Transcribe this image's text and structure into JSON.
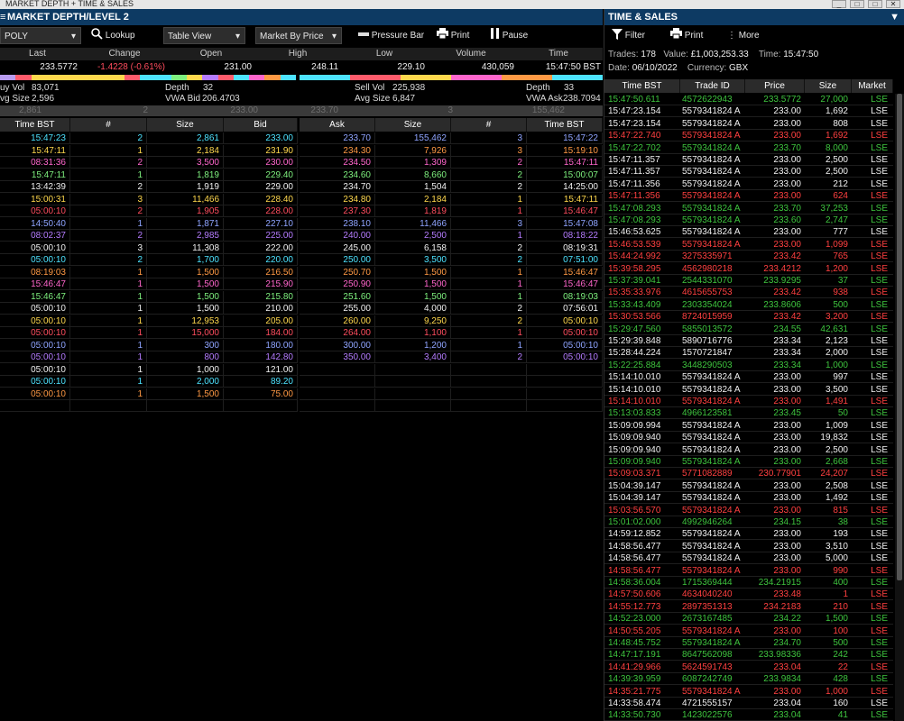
{
  "window": {
    "title": "MARKET DEPTH + TIME & SALES"
  },
  "md": {
    "title": "MARKET DEPTH/LEVEL 2",
    "symbol": "POLY",
    "lookup": "Lookup",
    "view": "Table View",
    "mode": "Market By Price",
    "pressure": "Pressure Bar",
    "print": "Print",
    "pause": "Pause"
  },
  "summary": {
    "headers": [
      "Last",
      "Change",
      "Open",
      "High",
      "Low",
      "Volume",
      "Time"
    ],
    "values": [
      "233.5772",
      "-1.4228 (-0.61%)",
      "231.00",
      "248.11",
      "229.10",
      "430,059",
      "15:47:50 BST"
    ]
  },
  "bid_bar": [
    "#b89cf0",
    "#ff5b6b",
    "#ffd84d",
    "#ffd84d",
    "#ffd84d",
    "#ffd84d",
    "#ffd84d",
    "#ffd84d",
    "#ff5b6b",
    "#4de3ff",
    "#4de3ff",
    "#7ef07e",
    "#ffd84d",
    "#b57cff",
    "#ff5b6b",
    "#4de3ff",
    "#ff66cc",
    "#ff9944",
    "#4de3ff"
  ],
  "ask_bar": [
    "#4de3ff",
    "#ff5b6b",
    "#ffd84d",
    "#ff66cc",
    "#ff9944",
    "#4de3ff"
  ],
  "info": {
    "buy_vol_label": "uy Vol",
    "buy_vol": "83,071",
    "avg_size_l_label": "vg Size",
    "avg_size_l": "2,596",
    "depth_l_label": "Depth",
    "depth_l": "32",
    "vwa_bid_label": "VWA Bid",
    "vwa_bid": "206.4703",
    "sell_vol_label": "Sell Vol",
    "sell_vol": "225,938",
    "avg_size_r_label": "Avg Size",
    "avg_size_r": "6,847",
    "depth_r_label": "Depth",
    "depth_r": "33",
    "vwa_ask_label": "VWA Ask",
    "vwa_ask": "238.7094"
  },
  "sep": [
    "2,861",
    "2",
    "233.00",
    "233.70",
    "3",
    "155,462"
  ],
  "cols": {
    "bid": [
      "Time BST",
      "#",
      "Size",
      "Bid"
    ],
    "ask": [
      "Ask",
      "Size",
      "#",
      "Time BST"
    ]
  },
  "colors": {
    "cyan": "#4de3ff",
    "yellow": "#ffd84d",
    "pink": "#ff66cc",
    "green": "#7ef07e",
    "red": "#ff4d5e",
    "purple": "#b57cff",
    "blue": "#8fa4ff",
    "white": "#f0f0f0",
    "orange": "#ff9944",
    "lightgreen": "#3ec43e",
    "redtext": "#ff4040"
  },
  "bids": [
    {
      "t": "15:47:23",
      "n": "2",
      "s": "2,861",
      "p": "233.00",
      "c": "cyan"
    },
    {
      "t": "15:47:11",
      "n": "1",
      "s": "2,184",
      "p": "231.90",
      "c": "yellow"
    },
    {
      "t": "08:31:36",
      "n": "2",
      "s": "3,500",
      "p": "230.00",
      "c": "pink"
    },
    {
      "t": "15:47:11",
      "n": "1",
      "s": "1,819",
      "p": "229.40",
      "c": "green"
    },
    {
      "t": "13:42:39",
      "n": "2",
      "s": "1,919",
      "p": "229.00",
      "c": "white"
    },
    {
      "t": "15:00:31",
      "n": "3",
      "s": "11,466",
      "p": "228.40",
      "c": "yellow"
    },
    {
      "t": "05:00:10",
      "n": "2",
      "s": "1,905",
      "p": "228.00",
      "c": "red"
    },
    {
      "t": "14:50:40",
      "n": "1",
      "s": "1,871",
      "p": "227.10",
      "c": "blue"
    },
    {
      "t": "08:02:37",
      "n": "2",
      "s": "2,985",
      "p": "225.00",
      "c": "purple"
    },
    {
      "t": "05:00:10",
      "n": "3",
      "s": "11,308",
      "p": "222.00",
      "c": "white"
    },
    {
      "t": "05:00:10",
      "n": "2",
      "s": "1,700",
      "p": "220.00",
      "c": "cyan"
    },
    {
      "t": "08:19:03",
      "n": "1",
      "s": "1,500",
      "p": "216.50",
      "c": "orange"
    },
    {
      "t": "15:46:47",
      "n": "1",
      "s": "1,500",
      "p": "215.90",
      "c": "pink"
    },
    {
      "t": "15:46:47",
      "n": "1",
      "s": "1,500",
      "p": "215.80",
      "c": "green"
    },
    {
      "t": "05:00:10",
      "n": "1",
      "s": "1,500",
      "p": "210.00",
      "c": "white"
    },
    {
      "t": "05:00:10",
      "n": "1",
      "s": "12,953",
      "p": "205.00",
      "c": "yellow"
    },
    {
      "t": "05:00:10",
      "n": "1",
      "s": "15,000",
      "p": "184.00",
      "c": "red"
    },
    {
      "t": "05:00:10",
      "n": "1",
      "s": "300",
      "p": "180.00",
      "c": "blue"
    },
    {
      "t": "05:00:10",
      "n": "1",
      "s": "800",
      "p": "142.80",
      "c": "purple"
    },
    {
      "t": "05:00:10",
      "n": "1",
      "s": "1,000",
      "p": "121.00",
      "c": "white"
    },
    {
      "t": "05:00:10",
      "n": "1",
      "s": "2,000",
      "p": "89.20",
      "c": "cyan"
    },
    {
      "t": "05:00:10",
      "n": "1",
      "s": "1,500",
      "p": "75.00",
      "c": "orange"
    }
  ],
  "asks": [
    {
      "p": "233.70",
      "s": "155,462",
      "n": "3",
      "t": "15:47:22",
      "c": "blue"
    },
    {
      "p": "234.30",
      "s": "7,926",
      "n": "3",
      "t": "15:19:10",
      "c": "orange"
    },
    {
      "p": "234.50",
      "s": "1,309",
      "n": "2",
      "t": "15:47:11",
      "c": "pink"
    },
    {
      "p": "234.60",
      "s": "8,660",
      "n": "2",
      "t": "15:00:07",
      "c": "green"
    },
    {
      "p": "234.70",
      "s": "1,504",
      "n": "2",
      "t": "14:25:00",
      "c": "white"
    },
    {
      "p": "234.80",
      "s": "2,184",
      "n": "1",
      "t": "15:47:11",
      "c": "yellow"
    },
    {
      "p": "237.30",
      "s": "1,819",
      "n": "1",
      "t": "15:46:47",
      "c": "red"
    },
    {
      "p": "238.10",
      "s": "11,466",
      "n": "3",
      "t": "15:47:08",
      "c": "blue"
    },
    {
      "p": "240.00",
      "s": "2,500",
      "n": "1",
      "t": "08:18:22",
      "c": "purple"
    },
    {
      "p": "245.00",
      "s": "6,158",
      "n": "2",
      "t": "08:19:31",
      "c": "white"
    },
    {
      "p": "250.00",
      "s": "3,500",
      "n": "2",
      "t": "07:51:00",
      "c": "cyan"
    },
    {
      "p": "250.70",
      "s": "1,500",
      "n": "1",
      "t": "15:46:47",
      "c": "orange"
    },
    {
      "p": "250.90",
      "s": "1,500",
      "n": "1",
      "t": "15:46:47",
      "c": "pink"
    },
    {
      "p": "251.60",
      "s": "1,500",
      "n": "1",
      "t": "08:19:03",
      "c": "green"
    },
    {
      "p": "255.00",
      "s": "4,000",
      "n": "2",
      "t": "07:56:01",
      "c": "white"
    },
    {
      "p": "260.00",
      "s": "9,250",
      "n": "2",
      "t": "05:00:10",
      "c": "yellow"
    },
    {
      "p": "264.00",
      "s": "1,100",
      "n": "1",
      "t": "05:00:10",
      "c": "red"
    },
    {
      "p": "300.00",
      "s": "1,200",
      "n": "1",
      "t": "05:00:10",
      "c": "blue"
    },
    {
      "p": "350.00",
      "s": "3,400",
      "n": "2",
      "t": "05:00:10",
      "c": "purple"
    }
  ],
  "ts": {
    "title": "TIME & SALES",
    "filter": "Filter",
    "print": "Print",
    "more": "More",
    "trades_label": "Trades:",
    "trades": "178",
    "value_label": "Value:",
    "value": "£1,003,253.33",
    "time_label": "Time:",
    "time": "15:47:50",
    "date_label": "Date:",
    "date": "06/10/2022",
    "currency_label": "Currency:",
    "currency": "GBX",
    "cols": [
      "Time BST",
      "Trade ID",
      "Price",
      "Size",
      "Market"
    ],
    "rows": [
      [
        "15:47:50.611",
        "4572622943",
        "233.5772",
        "27,000",
        "LSE",
        "g"
      ],
      [
        "15:47:23.154",
        "5579341824 A",
        "233.00",
        "1,692",
        "LSE",
        "w"
      ],
      [
        "15:47:23.154",
        "5579341824 A",
        "233.00",
        "808",
        "LSE",
        "w"
      ],
      [
        "15:47:22.740",
        "5579341824 A",
        "233.00",
        "1,692",
        "LSE",
        "r"
      ],
      [
        "15:47:22.702",
        "5579341824 A",
        "233.70",
        "8,000",
        "LSE",
        "g"
      ],
      [
        "15:47:11.357",
        "5579341824 A",
        "233.00",
        "2,500",
        "LSE",
        "w"
      ],
      [
        "15:47:11.357",
        "5579341824 A",
        "233.00",
        "2,500",
        "LSE",
        "w"
      ],
      [
        "15:47:11.356",
        "5579341824 A",
        "233.00",
        "212",
        "LSE",
        "w"
      ],
      [
        "15:47:11.356",
        "5579341824 A",
        "233.00",
        "624",
        "LSE",
        "r"
      ],
      [
        "15:47:08.293",
        "5579341824 A",
        "233.70",
        "37,253",
        "LSE",
        "g"
      ],
      [
        "15:47:08.293",
        "5579341824 A",
        "233.60",
        "2,747",
        "LSE",
        "g"
      ],
      [
        "15:46:53.625",
        "5579341824 A",
        "233.00",
        "777",
        "LSE",
        "w"
      ],
      [
        "15:46:53.539",
        "5579341824 A",
        "233.00",
        "1,099",
        "LSE",
        "r"
      ],
      [
        "15:44:24.992",
        "3275335971",
        "233.42",
        "765",
        "LSE",
        "r"
      ],
      [
        "15:39:58.295",
        "4562980218",
        "233.4212",
        "1,200",
        "LSE",
        "r"
      ],
      [
        "15:37:39.041",
        "2544331070",
        "233.9295",
        "37",
        "LSE",
        "g"
      ],
      [
        "15:35:33.976",
        "4615655753",
        "233.42",
        "938",
        "LSE",
        "r"
      ],
      [
        "15:33:43.409",
        "2303354024",
        "233.8606",
        "500",
        "LSE",
        "g"
      ],
      [
        "15:30:53.566",
        "8724015959",
        "233.42",
        "3,200",
        "LSE",
        "r"
      ],
      [
        "15:29:47.560",
        "5855013572",
        "234.55",
        "42,631",
        "LSE",
        "g"
      ],
      [
        "15:29:39.848",
        "5890716776",
        "233.34",
        "2,123",
        "LSE",
        "w"
      ],
      [
        "15:28:44.224",
        "1570721847",
        "233.34",
        "2,000",
        "LSE",
        "w"
      ],
      [
        "15:22:25.884",
        "3448290503",
        "233.34",
        "1,000",
        "LSE",
        "g"
      ],
      [
        "15:14:10.010",
        "5579341824 A",
        "233.00",
        "997",
        "LSE",
        "w"
      ],
      [
        "15:14:10.010",
        "5579341824 A",
        "233.00",
        "3,500",
        "LSE",
        "w"
      ],
      [
        "15:14:10.010",
        "5579341824 A",
        "233.00",
        "1,491",
        "LSE",
        "r"
      ],
      [
        "15:13:03.833",
        "4966123581",
        "233.45",
        "50",
        "LSE",
        "g"
      ],
      [
        "15:09:09.994",
        "5579341824 A",
        "233.00",
        "1,009",
        "LSE",
        "w"
      ],
      [
        "15:09:09.940",
        "5579341824 A",
        "233.00",
        "19,832",
        "LSE",
        "w"
      ],
      [
        "15:09:09.940",
        "5579341824 A",
        "233.00",
        "2,500",
        "LSE",
        "w"
      ],
      [
        "15:09:09.940",
        "5579341824 A",
        "233.00",
        "2,668",
        "LSE",
        "g"
      ],
      [
        "15:09:03.371",
        "5771082889",
        "230.77901",
        "24,207",
        "LSE",
        "r"
      ],
      [
        "15:04:39.147",
        "5579341824 A",
        "233.00",
        "2,508",
        "LSE",
        "w"
      ],
      [
        "15:04:39.147",
        "5579341824 A",
        "233.00",
        "1,492",
        "LSE",
        "w"
      ],
      [
        "15:03:56.570",
        "5579341824 A",
        "233.00",
        "815",
        "LSE",
        "r"
      ],
      [
        "15:01:02.000",
        "4992946264",
        "234.15",
        "38",
        "LSE",
        "g"
      ],
      [
        "14:59:12.852",
        "5579341824 A",
        "233.00",
        "193",
        "LSE",
        "w"
      ],
      [
        "14:58:56.477",
        "5579341824 A",
        "233.00",
        "3,510",
        "LSE",
        "w"
      ],
      [
        "14:58:56.477",
        "5579341824 A",
        "233.00",
        "5,000",
        "LSE",
        "w"
      ],
      [
        "14:58:56.477",
        "5579341824 A",
        "233.00",
        "990",
        "LSE",
        "r"
      ],
      [
        "14:58:36.004",
        "1715369444",
        "234.21915",
        "400",
        "LSE",
        "g"
      ],
      [
        "14:57:50.606",
        "4634040240",
        "233.48",
        "1",
        "LSE",
        "r"
      ],
      [
        "14:55:12.773",
        "2897351313",
        "234.2183",
        "210",
        "LSE",
        "r"
      ],
      [
        "14:52:23.000",
        "2673167485",
        "234.22",
        "1,500",
        "LSE",
        "g"
      ],
      [
        "14:50:55.205",
        "5579341824 A",
        "233.00",
        "100",
        "LSE",
        "r"
      ],
      [
        "14:48:45.752",
        "5579341824 A",
        "234.70",
        "500",
        "LSE",
        "g"
      ],
      [
        "14:47:17.191",
        "8647562098",
        "233.98336",
        "242",
        "LSE",
        "g"
      ],
      [
        "14:41:29.966",
        "5624591743",
        "233.04",
        "22",
        "LSE",
        "r"
      ],
      [
        "14:39:39.959",
        "6087242749",
        "233.9834",
        "428",
        "LSE",
        "g"
      ],
      [
        "14:35:21.775",
        "5579341824 A",
        "233.00",
        "1,000",
        "LSE",
        "r"
      ],
      [
        "14:33:58.474",
        "4721555157",
        "233.04",
        "160",
        "LSE",
        "w"
      ],
      [
        "14:33:50.730",
        "1423022576",
        "233.04",
        "41",
        "LSE",
        "g"
      ]
    ]
  }
}
